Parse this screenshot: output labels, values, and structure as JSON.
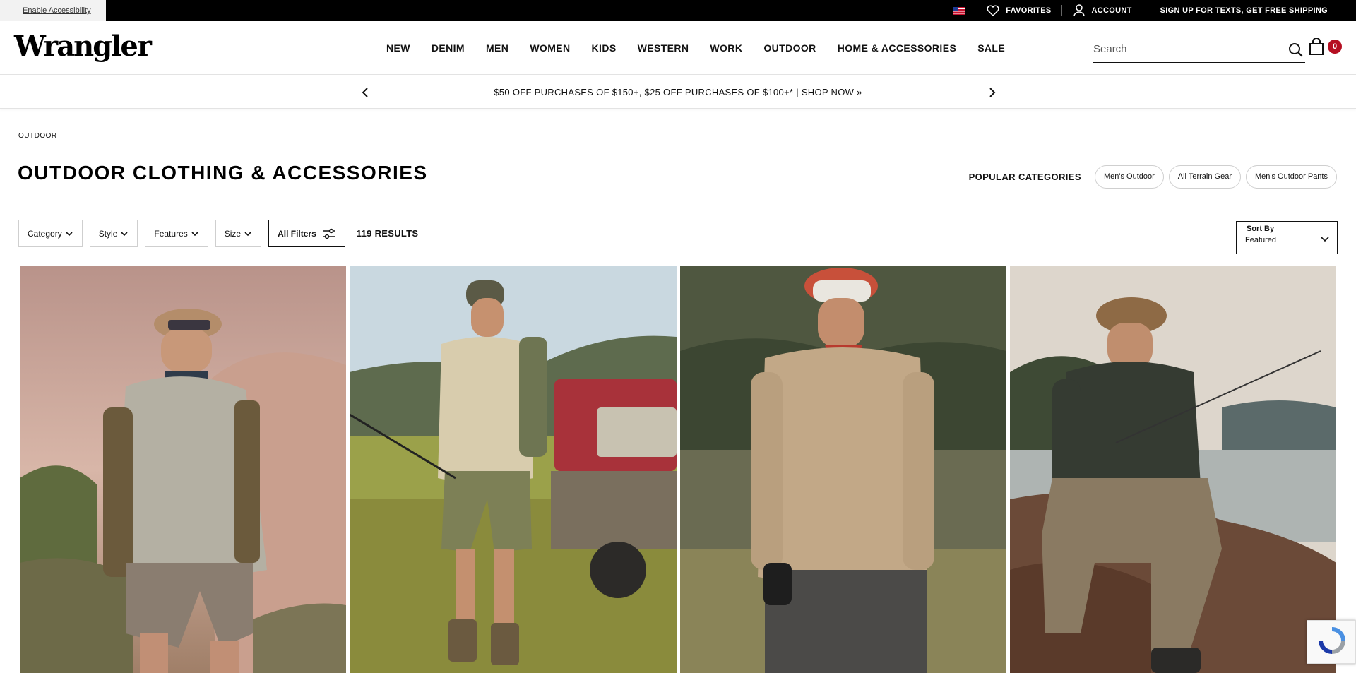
{
  "topbar": {
    "accessibility_link": "Enable Accessibility",
    "favorites": "FAVORITES",
    "account": "ACCOUNT",
    "shipping_promo": "SIGN UP FOR TEXTS, GET FREE SHIPPING"
  },
  "header": {
    "logo": "Wrangler",
    "nav": [
      "NEW",
      "DENIM",
      "MEN",
      "WOMEN",
      "KIDS",
      "WESTERN",
      "WORK",
      "OUTDOOR",
      "HOME & ACCESSORIES",
      "SALE"
    ],
    "search_placeholder": "Search",
    "cart_count": "0"
  },
  "promo": {
    "text": "$50 OFF PURCHASES OF $150+, $25 OFF PURCHASES OF $100+* | SHOP NOW »"
  },
  "page": {
    "breadcrumb": "OUTDOOR",
    "title": "OUTDOOR CLOTHING & ACCESSORIES",
    "popular_label": "POPULAR CATEGORIES",
    "popular_categories": [
      "Men's Outdoor",
      "All Terrain Gear",
      "Men's Outdoor Pants"
    ]
  },
  "filters": {
    "category": "Category",
    "style": "Style",
    "features": "Features",
    "size": "Size",
    "all_filters": "All Filters",
    "results": "119 RESULTS",
    "sort_label": "Sort By",
    "sort_value": "Featured"
  },
  "colors": {
    "accent_red": "#b50f22",
    "topbar": "#000000"
  },
  "products": [
    {
      "image": "hiker-with-backpack-photo"
    },
    {
      "image": "fisherman-by-truck-photo"
    },
    {
      "image": "man-with-binoculars-photo"
    },
    {
      "image": "angler-on-rock-photo"
    }
  ]
}
